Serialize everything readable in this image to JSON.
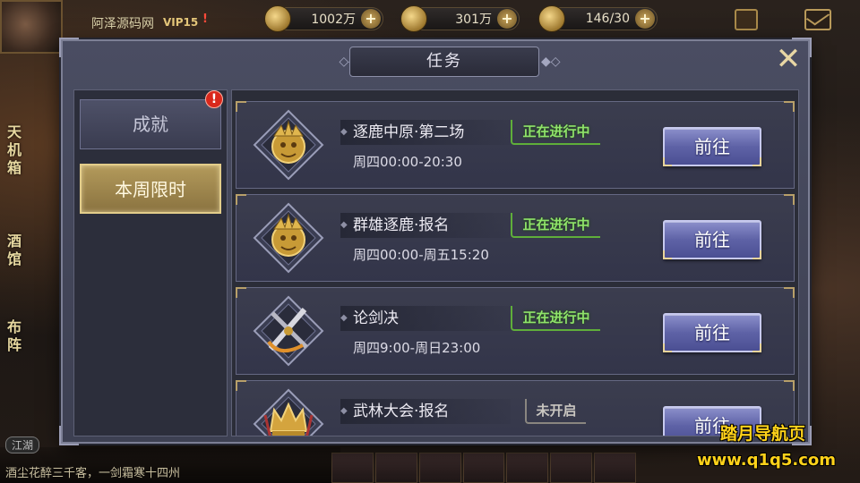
{
  "hud": {
    "player_name": "阿泽源码网",
    "vip": "VIP15",
    "resources": [
      {
        "icon": "ingot-icon",
        "value": "1002万"
      },
      {
        "icon": "coin-icon",
        "value": "301万"
      },
      {
        "icon": "stamina-icon",
        "value": "146/30"
      }
    ],
    "side_labels": [
      "天机箱",
      "酒馆",
      "布阵"
    ],
    "chat_channel": "江湖",
    "chat_line": "酒尘花醉三千客，一剑霜寒十四州"
  },
  "dialog": {
    "title": "任务",
    "tabs": [
      {
        "label": "成就",
        "active": false,
        "alert": "!"
      },
      {
        "label": "本周限时",
        "active": true
      }
    ],
    "tasks": [
      {
        "name": "逐鹿中原·第二场",
        "time": "周四00:00-20:30",
        "status": "正在进行中",
        "status_type": "active",
        "button": "前往",
        "emblem": "golden-beast-emblem-icon"
      },
      {
        "name": "群雄逐鹿·报名",
        "time": "周四00:00-周五15:20",
        "status": "正在进行中",
        "status_type": "active",
        "button": "前往",
        "emblem": "golden-beast-emblem-icon"
      },
      {
        "name": "论剑决",
        "time": "周四9:00-周日23:00",
        "status": "正在进行中",
        "status_type": "active",
        "button": "前往",
        "emblem": "crossed-swords-emblem-icon"
      },
      {
        "name": "武林大会·报名",
        "time": "",
        "status": "未开启",
        "status_type": "closed",
        "button": "前往",
        "emblem": "golden-crown-emblem-icon"
      }
    ]
  },
  "watermark": {
    "line1": "踏月导航页",
    "line2": "www.q1q5.com"
  },
  "colors": {
    "status_active": "#8fe36a",
    "button_fill": "#5e62a6",
    "tab_active": "#b39a5b"
  }
}
